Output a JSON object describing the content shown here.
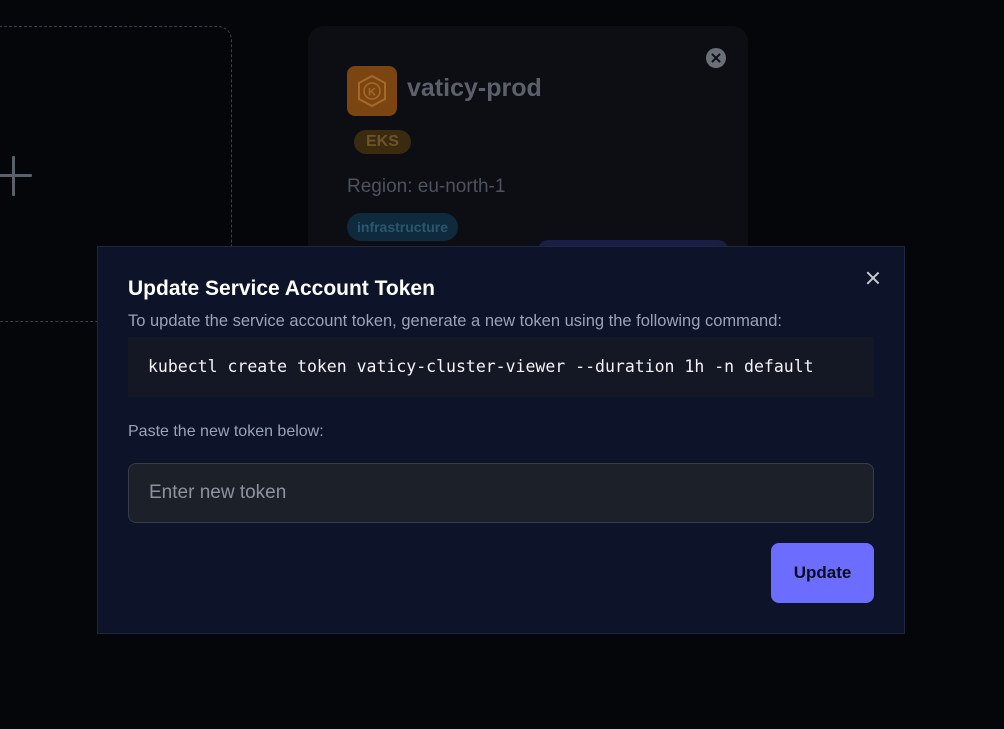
{
  "background": {
    "cluster_card": {
      "name": "vaticy-prod",
      "type_badge": "EKS",
      "region": "Region: eu-north-1",
      "tag": "infrastructure",
      "logo_icon": "kubernetes-icon",
      "logo_letter": "K"
    },
    "add_card": {
      "icon": "plus-icon"
    }
  },
  "modal": {
    "title": "Update Service Account Token",
    "description": "To update the service account token, generate a new token using the following command:",
    "command": "kubectl create token vaticy-cluster-viewer --duration 1h -n default",
    "paste_label": "Paste the new token below:",
    "token_input": {
      "value": "",
      "placeholder": "Enter new token"
    },
    "update_label": "Update",
    "close_icon": "close-icon"
  },
  "colors": {
    "accent": "#6c6cff",
    "modal_bg": "#0d1328",
    "page_bg": "#050609",
    "eks_orange": "#7a4510"
  }
}
